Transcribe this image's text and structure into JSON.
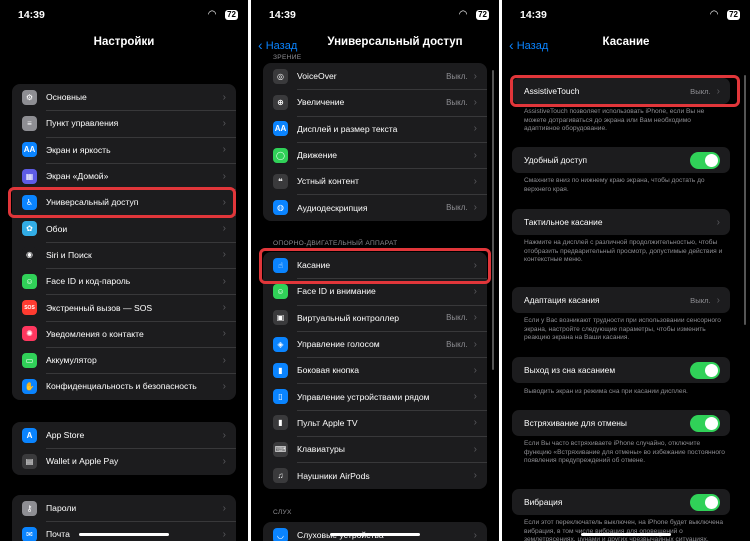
{
  "status": {
    "time": "14:39",
    "battery": "72",
    "wifi": "wifi-icon"
  },
  "settings": {
    "title": "Настройки",
    "group1": [
      {
        "label": "Основные",
        "icon": "gear-icon",
        "color": "#8e8e93"
      },
      {
        "label": "Пункт управления",
        "icon": "switches-icon",
        "color": "#8e8e93"
      },
      {
        "label": "Экран и яркость",
        "icon": "text-size-icon",
        "color": "#0a84ff"
      },
      {
        "label": "Экран «Домой»",
        "icon": "home-grid-icon",
        "color": "#5e5ce6"
      },
      {
        "label": "Универсальный доступ",
        "icon": "accessibility-icon",
        "color": "#0a84ff"
      },
      {
        "label": "Обои",
        "icon": "flower-icon",
        "color": "#32ade6"
      },
      {
        "label": "Siri и Поиск",
        "icon": "siri-icon",
        "color": "#1c1c1e"
      },
      {
        "label": "Face ID и код-пароль",
        "icon": "face-id-icon",
        "color": "#30d158"
      },
      {
        "label": "Экстренный вызов — SOS",
        "icon": "sos-icon",
        "color": "#ff3b30"
      },
      {
        "label": "Уведомления о контакте",
        "icon": "exposure-icon",
        "color": "#ff375f"
      },
      {
        "label": "Аккумулятор",
        "icon": "battery-icon",
        "color": "#30d158"
      },
      {
        "label": "Конфиденциальность и безопасность",
        "icon": "hand-icon",
        "color": "#0a84ff"
      }
    ],
    "group2": [
      {
        "label": "App Store",
        "icon": "app-store-icon",
        "color": "#0a84ff"
      },
      {
        "label": "Wallet и Apple Pay",
        "icon": "wallet-icon",
        "color": "#3a3a3c"
      }
    ],
    "group3": [
      {
        "label": "Пароли",
        "icon": "key-icon",
        "color": "#8e8e93"
      },
      {
        "label": "Почта",
        "icon": "mail-icon",
        "color": "#0a84ff"
      }
    ]
  },
  "accessibility": {
    "back": "Назад",
    "title": "Универсальный доступ",
    "section_top": "ЗРЕНИЕ",
    "vision": [
      {
        "label": "VoiceOver",
        "value": "Выкл.",
        "icon": "voiceover-icon",
        "color": "#3a3a3c"
      },
      {
        "label": "Увеличение",
        "value": "Выкл.",
        "icon": "zoom-icon",
        "color": "#3a3a3c"
      },
      {
        "label": "Дисплей и размер текста",
        "value": "",
        "icon": "text-size-icon",
        "color": "#0a84ff"
      },
      {
        "label": "Движение",
        "value": "",
        "icon": "motion-icon",
        "color": "#30d158"
      },
      {
        "label": "Устный контент",
        "value": "",
        "icon": "speech-bubble-icon",
        "color": "#3a3a3c"
      },
      {
        "label": "Аудиодескрипция",
        "value": "Выкл.",
        "icon": "audio-description-icon",
        "color": "#0a84ff"
      }
    ],
    "section_motor": "ОПОРНО-ДВИГАТЕЛЬНЫЙ АППАРАТ",
    "motor": [
      {
        "label": "Касание",
        "value": "",
        "icon": "touch-hand-icon",
        "color": "#0a84ff"
      },
      {
        "label": "Face ID и внимание",
        "value": "",
        "icon": "face-id-icon",
        "color": "#30d158"
      },
      {
        "label": "Виртуальный контроллер",
        "value": "Выкл.",
        "icon": "switch-control-icon",
        "color": "#3a3a3c"
      },
      {
        "label": "Управление голосом",
        "value": "Выкл.",
        "icon": "voice-control-icon",
        "color": "#0a84ff"
      },
      {
        "label": "Боковая кнопка",
        "value": "",
        "icon": "side-button-icon",
        "color": "#0a84ff"
      },
      {
        "label": "Управление устройствами рядом",
        "value": "",
        "icon": "nearby-devices-icon",
        "color": "#0a84ff"
      },
      {
        "label": "Пульт Apple TV",
        "value": "",
        "icon": "remote-icon",
        "color": "#3a3a3c"
      },
      {
        "label": "Клавиатуры",
        "value": "",
        "icon": "keyboard-icon",
        "color": "#3a3a3c"
      },
      {
        "label": "Наушники AirPods",
        "value": "",
        "icon": "airpods-icon",
        "color": "#3a3a3c"
      }
    ],
    "section_hearing": "СЛУХ",
    "hearing": [
      {
        "label": "Слуховые устройства",
        "value": "",
        "icon": "ear-icon",
        "color": "#0a84ff"
      }
    ]
  },
  "touch": {
    "back": "Назад",
    "title": "Касание",
    "assistive": {
      "label": "AssistiveTouch",
      "value": "Выкл.",
      "desc": "AssistiveTouch позволяет использовать iPhone, если Вы не можете дотрагиваться до экрана или Вам необходимо адаптивное оборудование."
    },
    "reach": {
      "label": "Удобный доступ",
      "desc": "Смахните вниз по нижнему краю экрана, чтобы достать до верхнего края."
    },
    "haptic": {
      "label": "Тактильное касание",
      "desc": "Нажмите на дисплей с различной продолжительностью, чтобы отобразить предварительный просмотр, допустимые действия и контекстные меню."
    },
    "accommodations": {
      "label": "Адаптация касания",
      "value": "Выкл.",
      "desc": "Если у Вас возникают трудности при использовании сенсорного экрана, настройте следующие параметры, чтобы изменить реакцию экрана на Ваши касания."
    },
    "tapwake": {
      "label": "Выход из сна касанием",
      "desc": "Выводить экран из режима сна при касании дисплея."
    },
    "shake": {
      "label": "Встряхивание для отмены",
      "desc": "Если Вы часто встряхиваете iPhone случайно, отключите функцию «Встряхивание для отмены» во избежание постоянного появления предупреждений об отмене."
    },
    "vibration": {
      "label": "Вибрация",
      "desc": "Если этот переключатель выключен, на iPhone будет выключена вибрация, в том числе вибрация для оповещений о землетрясениях, цунами и других чрезвычайных ситуациях."
    }
  }
}
